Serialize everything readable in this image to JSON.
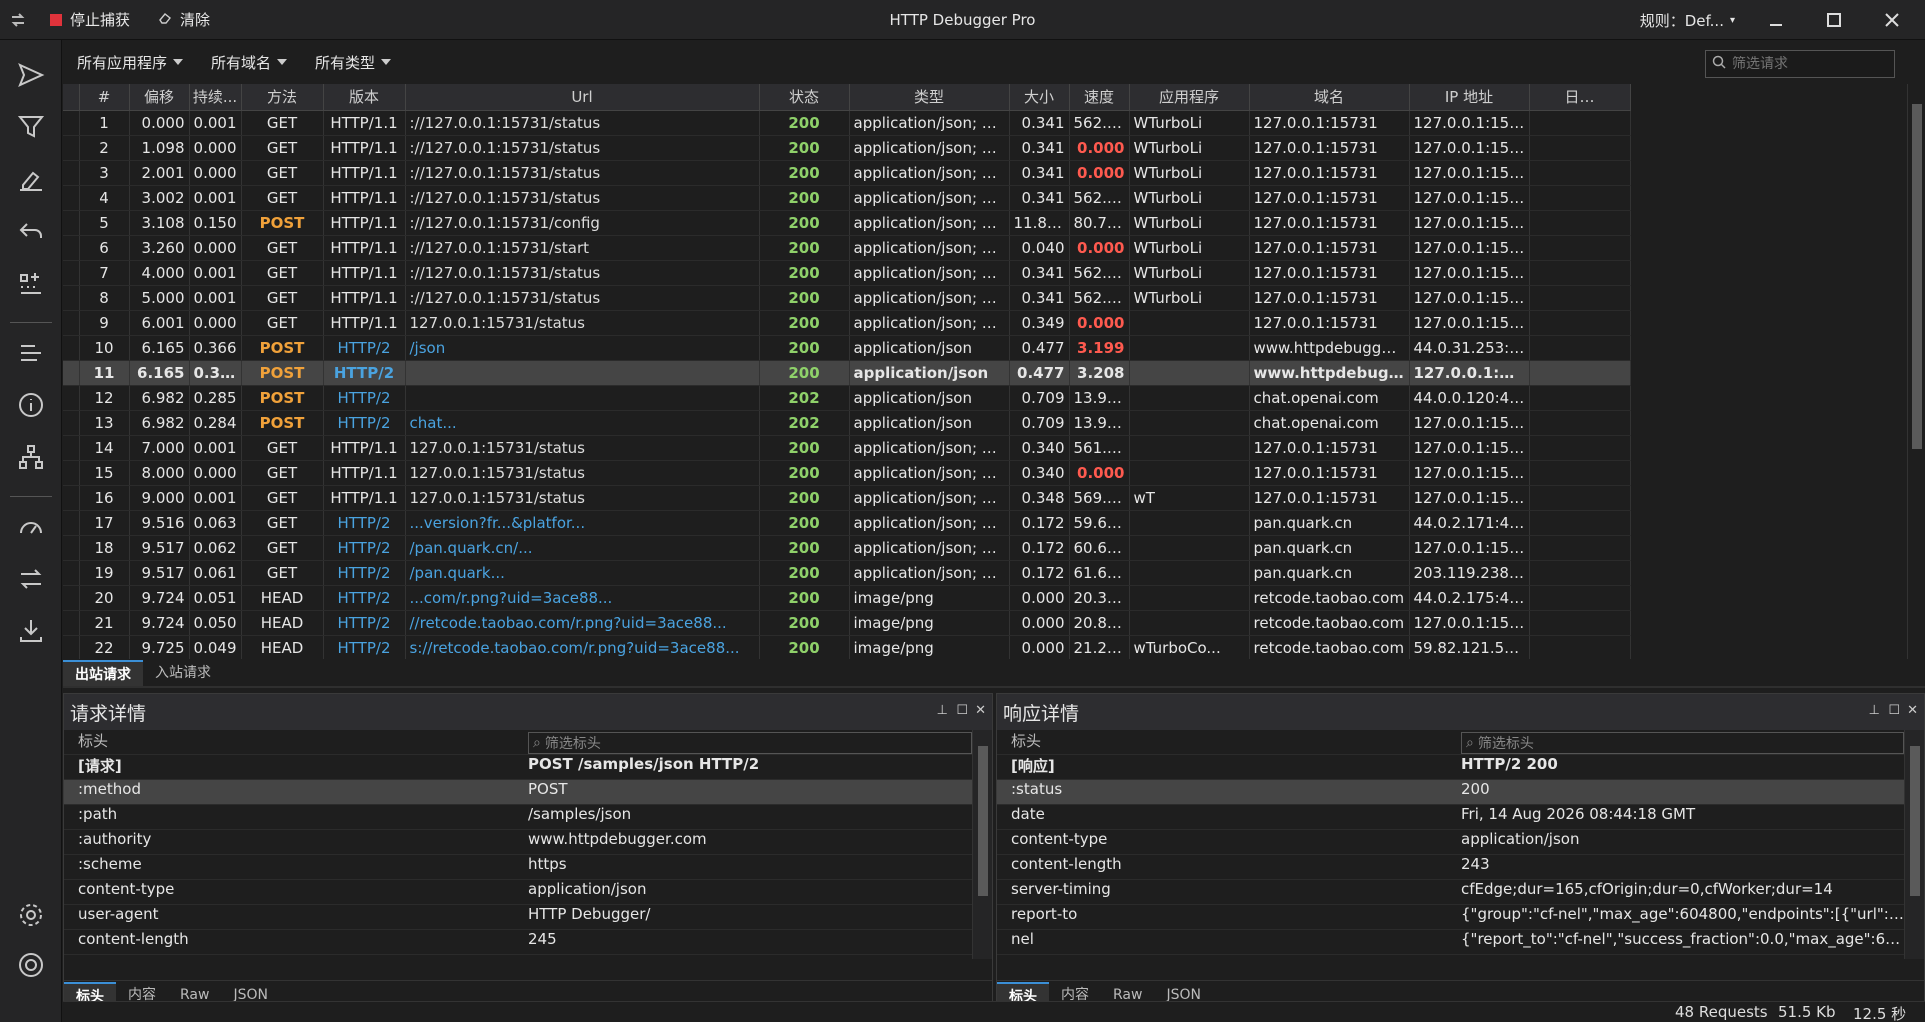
{
  "titlebar": {
    "title": "HTTP Debugger Pro",
    "stop_label": "停止捕获",
    "clear_label": "清除",
    "rules_label": "规则：Def..."
  },
  "filters": {
    "apps": "所有应用程序",
    "domains": "所有域名",
    "types": "所有类型",
    "search_placeholder": "筛选请求"
  },
  "columns": [
    "#",
    "偏移",
    "持续...",
    "方法",
    "版本",
    "Url",
    "状态",
    "类型",
    "大小",
    "速度",
    "应用程序",
    "域名",
    "IP 地址",
    "日…"
  ],
  "rows": [
    {
      "n": "1",
      "off": "0.000",
      "dur": "0.001",
      "m": "GET",
      "v": "HTTP/1.1",
      "url": "://127.0.0.1:15731/status",
      "st": "200",
      "type": "application/json; ch...",
      "size": "0.341",
      "speed": "562.5...",
      "app": "WTurboLi",
      "dom": "127.0.0.1:15731",
      "ip": "127.0.0.1:15731"
    },
    {
      "n": "2",
      "off": "1.098",
      "dur": "0.000",
      "m": "GET",
      "v": "HTTP/1.1",
      "url": "://127.0.0.1:15731/status",
      "st": "200",
      "type": "application/json; ch...",
      "size": "0.341",
      "speed": "0.000",
      "app": "WTurboLi",
      "dom": "127.0.0.1:15731",
      "ip": "127.0.0.1:15731"
    },
    {
      "n": "3",
      "off": "2.001",
      "dur": "0.000",
      "m": "GET",
      "v": "HTTP/1.1",
      "url": "://127.0.0.1:15731/status",
      "st": "200",
      "type": "application/json; ch...",
      "size": "0.341",
      "speed": "0.000",
      "app": "WTurboLi",
      "dom": "127.0.0.1:15731",
      "ip": "127.0.0.1:15731"
    },
    {
      "n": "4",
      "off": "3.002",
      "dur": "0.001",
      "m": "GET",
      "v": "HTTP/1.1",
      "url": "://127.0.0.1:15731/status",
      "st": "200",
      "type": "application/json; ch...",
      "size": "0.341",
      "speed": "562.5...",
      "app": "WTurboLi",
      "dom": "127.0.0.1:15731",
      "ip": "127.0.0.1:15731"
    },
    {
      "n": "5",
      "off": "3.108",
      "dur": "0.150",
      "m": "POST",
      "v": "HTTP/1.1",
      "url": "://127.0.0.1:15731/config",
      "st": "200",
      "type": "application/json; ch...",
      "size": "11.840",
      "speed": "80.768",
      "app": "WTurboLi",
      "dom": "127.0.0.1:15731",
      "ip": "127.0.0.1:15731"
    },
    {
      "n": "6",
      "off": "3.260",
      "dur": "0.000",
      "m": "GET",
      "v": "HTTP/1.1",
      "url": "://127.0.0.1:15731/start",
      "st": "200",
      "type": "application/json; ch...",
      "size": "0.040",
      "speed": "0.000",
      "app": "WTurboLi",
      "dom": "127.0.0.1:15731",
      "ip": "127.0.0.1:15731"
    },
    {
      "n": "7",
      "off": "4.000",
      "dur": "0.001",
      "m": "GET",
      "v": "HTTP/1.1",
      "url": "://127.0.0.1:15731/status",
      "st": "200",
      "type": "application/json; ch...",
      "size": "0.341",
      "speed": "562.5...",
      "app": "WTurboLi",
      "dom": "127.0.0.1:15731",
      "ip": "127.0.0.1:15731"
    },
    {
      "n": "8",
      "off": "5.000",
      "dur": "0.001",
      "m": "GET",
      "v": "HTTP/1.1",
      "url": "://127.0.0.1:15731/status",
      "st": "200",
      "type": "application/json; ch...",
      "size": "0.341",
      "speed": "562.5...",
      "app": "WTurboLi",
      "dom": "127.0.0.1:15731",
      "ip": "127.0.0.1:15731"
    },
    {
      "n": "9",
      "off": "6.001",
      "dur": "0.000",
      "m": "GET",
      "v": "HTTP/1.1",
      "url": "127.0.0.1:15731/status",
      "st": "200",
      "type": "application/json; ch...",
      "size": "0.349",
      "speed": "0.000",
      "app": "",
      "dom": "127.0.0.1:15731",
      "ip": "127.0.0.1:15731"
    },
    {
      "n": "10",
      "off": "6.165",
      "dur": "0.366",
      "m": "POST",
      "v": "HTTP/2",
      "url": "/json",
      "st": "200",
      "type": "application/json",
      "size": "0.477",
      "speed": "3.199",
      "app": "",
      "dom": "www.httpdebugger...",
      "ip": "44.0.31.253:443"
    },
    {
      "n": "11",
      "off": "6.165",
      "dur": "0.365",
      "m": "POST",
      "v": "HTTP/2",
      "url": "",
      "st": "200",
      "type": "application/json",
      "size": "0.477",
      "speed": "3.208",
      "app": "",
      "dom": "www.httpdebugger...",
      "ip": "127.0.0.1:15732"
    },
    {
      "n": "12",
      "off": "6.982",
      "dur": "0.285",
      "m": "POST",
      "v": "HTTP/2",
      "url": "",
      "st": "202",
      "type": "application/json",
      "size": "0.709",
      "speed": "13.946",
      "app": "",
      "dom": "chat.openai.com",
      "ip": "44.0.0.120:443"
    },
    {
      "n": "13",
      "off": "6.982",
      "dur": "0.284",
      "m": "POST",
      "v": "HTTP/2",
      "url": "chat...",
      "st": "202",
      "type": "application/json",
      "size": "0.709",
      "speed": "13.995",
      "app": "",
      "dom": "chat.openai.com",
      "ip": "127.0.0.1:15732"
    },
    {
      "n": "14",
      "off": "7.000",
      "dur": "0.001",
      "m": "GET",
      "v": "HTTP/1.1",
      "url": "127.0.0.1:15731/status",
      "st": "200",
      "type": "application/json; ch...",
      "size": "0.340",
      "speed": "561.5...",
      "app": "",
      "dom": "127.0.0.1:15731",
      "ip": "127.0.0.1:15731"
    },
    {
      "n": "15",
      "off": "8.000",
      "dur": "0.000",
      "m": "GET",
      "v": "HTTP/1.1",
      "url": "127.0.0.1:15731/status",
      "st": "200",
      "type": "application/json; ch...",
      "size": "0.340",
      "speed": "0.000",
      "app": "",
      "dom": "127.0.0.1:15731",
      "ip": "127.0.0.1:15731"
    },
    {
      "n": "16",
      "off": "9.000",
      "dur": "0.001",
      "m": "GET",
      "v": "HTTP/1.1",
      "url": "127.0.0.1:15731/status",
      "st": "200",
      "type": "application/json; ch...",
      "size": "0.348",
      "speed": "569.3...",
      "app": "wT",
      "dom": "127.0.0.1:15731",
      "ip": "127.0.0.1:15731"
    },
    {
      "n": "17",
      "off": "9.516",
      "dur": "0.063",
      "m": "GET",
      "v": "HTTP/2",
      "url": "...version?fr...&platfor...",
      "st": "200",
      "type": "application/json; ch...",
      "size": "0.172",
      "speed": "59.648",
      "app": "",
      "dom": "pan.quark.cn",
      "ip": "44.0.2.171:443"
    },
    {
      "n": "18",
      "off": "9.517",
      "dur": "0.062",
      "m": "GET",
      "v": "HTTP/2",
      "url": "/pan.quark.cn/...",
      "st": "200",
      "type": "application/json; ch...",
      "size": "0.172",
      "speed": "60.610",
      "app": "",
      "dom": "pan.quark.cn",
      "ip": "127.0.0.1:15732"
    },
    {
      "n": "19",
      "off": "9.517",
      "dur": "0.061",
      "m": "GET",
      "v": "HTTP/2",
      "url": "/pan.quark...",
      "st": "200",
      "type": "application/json; ch...",
      "size": "0.172",
      "speed": "61.603",
      "app": "",
      "dom": "pan.quark.cn",
      "ip": "203.119.238.4..."
    },
    {
      "n": "20",
      "off": "9.724",
      "dur": "0.051",
      "m": "HEAD",
      "v": "HTTP/2",
      "url": "...com/r.png?uid=3ace88...",
      "st": "200",
      "type": "image/png",
      "size": "0.000",
      "speed": "20.393",
      "app": "",
      "dom": "retcode.taobao.com",
      "ip": "44.0.2.175:443"
    },
    {
      "n": "21",
      "off": "9.724",
      "dur": "0.050",
      "m": "HEAD",
      "v": "HTTP/2",
      "url": "//retcode.taobao.com/r.png?uid=3ace88...",
      "st": "200",
      "type": "image/png",
      "size": "0.000",
      "speed": "20.801",
      "app": "",
      "dom": "retcode.taobao.com",
      "ip": "127.0.0.1:15732"
    },
    {
      "n": "22",
      "off": "9.725",
      "dur": "0.049",
      "m": "HEAD",
      "v": "HTTP/2",
      "url": "s://retcode.taobao.com/r.png?uid=3ace88...",
      "st": "200",
      "type": "image/png",
      "size": "0.000",
      "speed": "21.265",
      "app": "wTurboCo...",
      "dom": "retcode.taobao.com",
      "ip": "59.82.121.55:..."
    }
  ],
  "io_tabs": {
    "outbound": "出站请求",
    "inbound": "入站请求"
  },
  "request_panel": {
    "title": "请求详情",
    "col_key": "标头",
    "filter_placeholder": "筛选标头",
    "head_key": "[请求]",
    "head_val": "POST /samples/json HTTP/2",
    "rows": [
      {
        "k": ":method",
        "v": "POST"
      },
      {
        "k": ":path",
        "v": "/samples/json"
      },
      {
        "k": ":authority",
        "v": "www.httpdebugger.com"
      },
      {
        "k": ":scheme",
        "v": "https"
      },
      {
        "k": "content-type",
        "v": "application/json"
      },
      {
        "k": "user-agent",
        "v": "HTTP Debugger/"
      },
      {
        "k": "content-length",
        "v": "245"
      }
    ],
    "tabs": [
      "标头",
      "内容",
      "Raw",
      "JSON"
    ]
  },
  "response_panel": {
    "title": "响应详情",
    "col_key": "标头",
    "filter_placeholder": "筛选标头",
    "head_key": "[响应]",
    "head_val": "HTTP/2 200",
    "rows": [
      {
        "k": ":status",
        "v": "200"
      },
      {
        "k": "date",
        "v": "Fri, 14 Aug 2026 08:44:18 GMT"
      },
      {
        "k": "content-type",
        "v": "application/json"
      },
      {
        "k": "content-length",
        "v": "243"
      },
      {
        "k": "server-timing",
        "v": "cfEdge;dur=165,cfOrigin;dur=0,cfWorker;dur=14"
      },
      {
        "k": "report-to",
        "v": "{\"group\":\"cf-nel\",\"max_age\":604800,\"endpoints\":[{\"url\":\"ht..."
      },
      {
        "k": "nel",
        "v": "{\"report_to\":\"cf-nel\",\"success_fraction\":0.0,\"max_age\":604..."
      }
    ],
    "tabs": [
      "标头",
      "内容",
      "Raw",
      "JSON"
    ]
  },
  "status": {
    "requests": "48 Requests",
    "size": "51.5 Kb",
    "time": "12.5 秒"
  }
}
